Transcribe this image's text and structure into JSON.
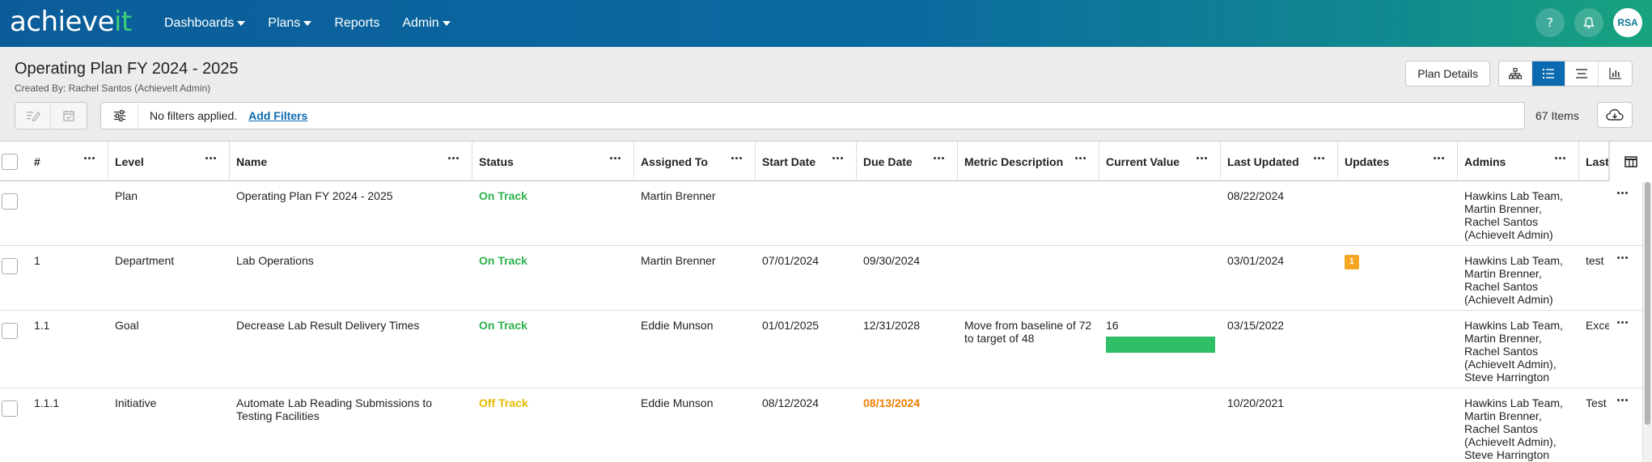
{
  "app": {
    "logo_main": "achieve",
    "logo_accent": "it",
    "nav": [
      {
        "label": "Dashboards",
        "has_caret": true
      },
      {
        "label": "Plans",
        "has_caret": true
      },
      {
        "label": "Reports",
        "has_caret": false
      },
      {
        "label": "Admin",
        "has_caret": true
      }
    ],
    "help_icon": "question-icon",
    "notifications_icon": "bell-icon",
    "avatar_initials": "RSA",
    "colors": {
      "brand_blue": "#0b5d9a",
      "brand_green": "#18a37e",
      "on_track": "#2db24c",
      "off_track": "#e6b800",
      "overdue": "#ef7d00",
      "link": "#0b6ab0"
    }
  },
  "page": {
    "title": "Operating Plan FY 2024 - 2025",
    "created_by": "Created By: Rachel Santos (AchieveIt Admin)",
    "plan_details_label": "Plan Details",
    "view_modes": [
      {
        "icon": "hierarchy-icon",
        "active": false
      },
      {
        "icon": "list-icon",
        "active": true
      },
      {
        "icon": "lines-icon",
        "active": false
      },
      {
        "icon": "bar-chart-icon",
        "active": false
      }
    ]
  },
  "toolbar": {
    "no_filters": "No filters applied.",
    "add_filters": "Add Filters",
    "item_count": "67 Items"
  },
  "table": {
    "columns": [
      "#",
      "Level",
      "Name",
      "Status",
      "Assigned To",
      "Start Date",
      "Due Date",
      "Metric Description",
      "Current Value",
      "Last Updated",
      "Updates",
      "Admins",
      "Last"
    ],
    "rows": [
      {
        "num": "",
        "level": "Plan",
        "name": "Operating Plan FY 2024 - 2025",
        "status": "On Track",
        "assigned": "Martin Brenner",
        "start": "",
        "due": "",
        "metric": "",
        "current": "",
        "updated": "08/22/2024",
        "updates": "",
        "admins": "Hawkins Lab Team, Martin Brenner, Rachel Santos (AchieveIt Admin)",
        "last": ""
      },
      {
        "num": "1",
        "level": "Department",
        "name": "Lab Operations",
        "status": "On Track",
        "assigned": "Martin Brenner",
        "start": "07/01/2024",
        "due": "09/30/2024",
        "metric": "",
        "current": "",
        "updated": "03/01/2024",
        "updates": "1",
        "admins": "Hawkins Lab Team, Martin Brenner, Rachel Santos (AchieveIt Admin)",
        "last": "test"
      },
      {
        "num": "1.1",
        "level": "Goal",
        "name": "Decrease Lab Result Delivery Times",
        "status": "On Track",
        "assigned": "Eddie Munson",
        "start": "01/01/2025",
        "due": "12/31/2028",
        "metric": "Move from baseline of 72 to target of 48",
        "current": "16",
        "current_progress": 1.0,
        "updated": "03/15/2022",
        "updates": "",
        "admins": "Hawkins Lab Team, Martin Brenner, Rachel Santos (AchieveIt Admin), Steve Harrington",
        "last": "Exce"
      },
      {
        "num": "1.1.1",
        "level": "Initiative",
        "name": "Automate Lab Reading Submissions to Testing Facilities",
        "status": "Off Track",
        "assigned": "Eddie Munson",
        "start": "08/12/2024",
        "due": "08/13/2024",
        "metric": "",
        "current": "",
        "updated": "10/20/2021",
        "updates": "",
        "admins": "Hawkins Lab Team, Martin Brenner, Rachel Santos (AchieveIt Admin), Steve Harrington",
        "last": "Test"
      }
    ]
  }
}
